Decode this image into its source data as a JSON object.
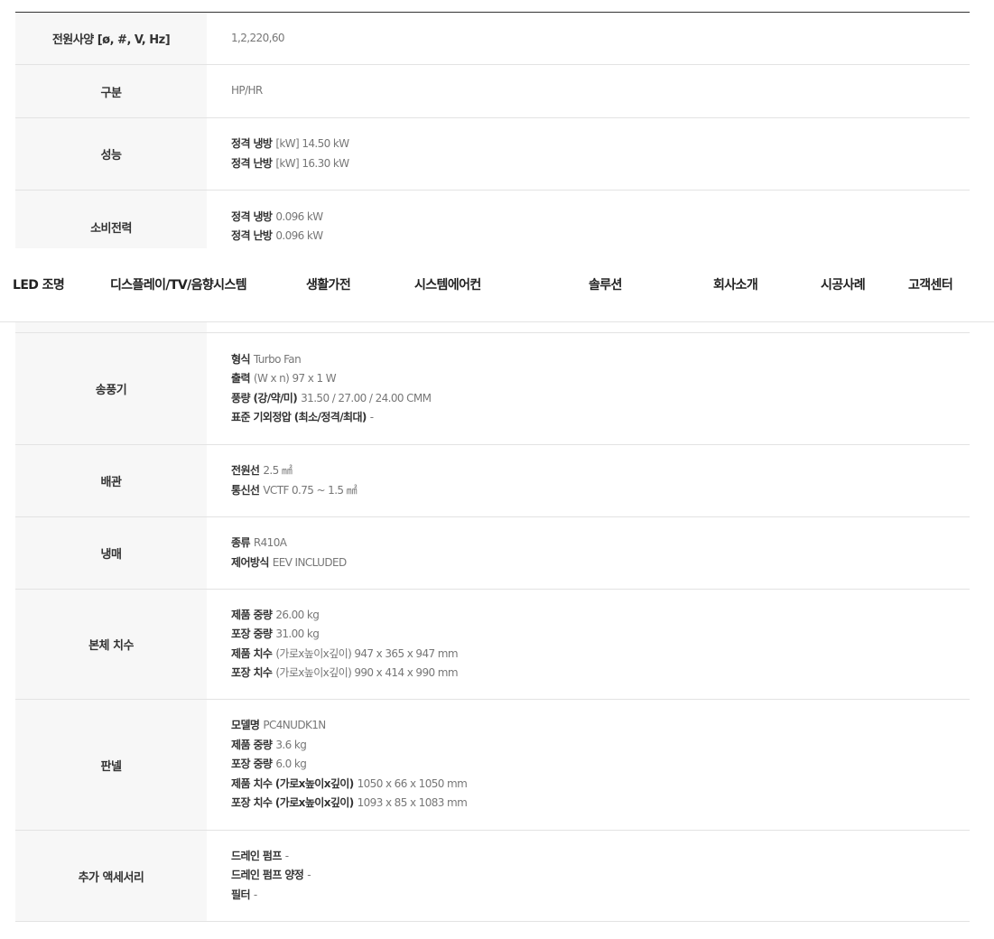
{
  "nav": {
    "items": [
      "LED 조명",
      "디스플레이/TV/음향시스템",
      "생활가전",
      "시스템에어컨",
      "솔루션",
      "회사소개",
      "시공사례",
      "고객센터"
    ]
  },
  "specs_top": [
    {
      "label": "전원사양 [ø, #, V, Hz]",
      "plain": "1,2,220,60"
    },
    {
      "label": "구분",
      "plain": "HP/HR"
    },
    {
      "label": "성능",
      "lines": [
        {
          "key": "정격 냉방",
          "value": "[kW] 14.50 kW"
        },
        {
          "key": "정격 난방",
          "value": "[kW] 16.30 kW"
        }
      ]
    },
    {
      "label": "소비전력",
      "lines": [
        {
          "key": "정격 냉방",
          "value": "0.096 kW"
        },
        {
          "key": "정격 난방",
          "value": "0.096 kW"
        }
      ]
    }
  ],
  "specs_bottom": [
    {
      "label": "송풍기",
      "lines": [
        {
          "key": "형식",
          "value": "Turbo Fan"
        },
        {
          "key": "출력",
          "value": "(W x n) 97 x 1 W"
        },
        {
          "key": "풍량 (강/약/미)",
          "value": "31.50 / 27.00 / 24.00 CMM"
        },
        {
          "key": "표준 기외정압 (최소/정격/최대)",
          "value": "-"
        }
      ]
    },
    {
      "label": "배관",
      "lines": [
        {
          "key": "전원선",
          "value": "2.5 ㎟"
        },
        {
          "key": "통신선",
          "value": "VCTF 0.75 ~ 1.5 ㎟"
        }
      ]
    },
    {
      "label": "냉매",
      "lines": [
        {
          "key": "종류",
          "value": "R410A"
        },
        {
          "key": "제어방식",
          "value": "EEV INCLUDED"
        }
      ]
    },
    {
      "label": "본체 치수",
      "lines": [
        {
          "key": "제품 중량",
          "value": "26.00 kg"
        },
        {
          "key": "포장 중량",
          "value": "31.00 kg"
        },
        {
          "key": "제품 치수",
          "value": "(가로x높이x깊이) 947 x 365 x 947 mm"
        },
        {
          "key": "포장 치수",
          "value": "(가로x높이x깊이) 990 x 414 x 990 mm"
        }
      ]
    },
    {
      "label": "판넬",
      "lines": [
        {
          "key": "모델명",
          "value": "PC4NUDK1N"
        },
        {
          "key": "제품 중량",
          "value": "3.6 kg"
        },
        {
          "key": "포장 중량",
          "value": "6.0 kg"
        },
        {
          "key": "제품 치수 (가로x높이x깊이)",
          "value": "1050 x 66 x 1050 mm"
        },
        {
          "key": "포장 치수 (가로x높이x깊이)",
          "value": "1093 x 85 x 1083 mm"
        }
      ]
    },
    {
      "label": "추가 액세서리",
      "lines": [
        {
          "key": "드레인 펌프",
          "value": "-"
        },
        {
          "key": "드레인 펌프 양정",
          "value": "-"
        },
        {
          "key": "필터",
          "value": "-"
        }
      ]
    }
  ]
}
